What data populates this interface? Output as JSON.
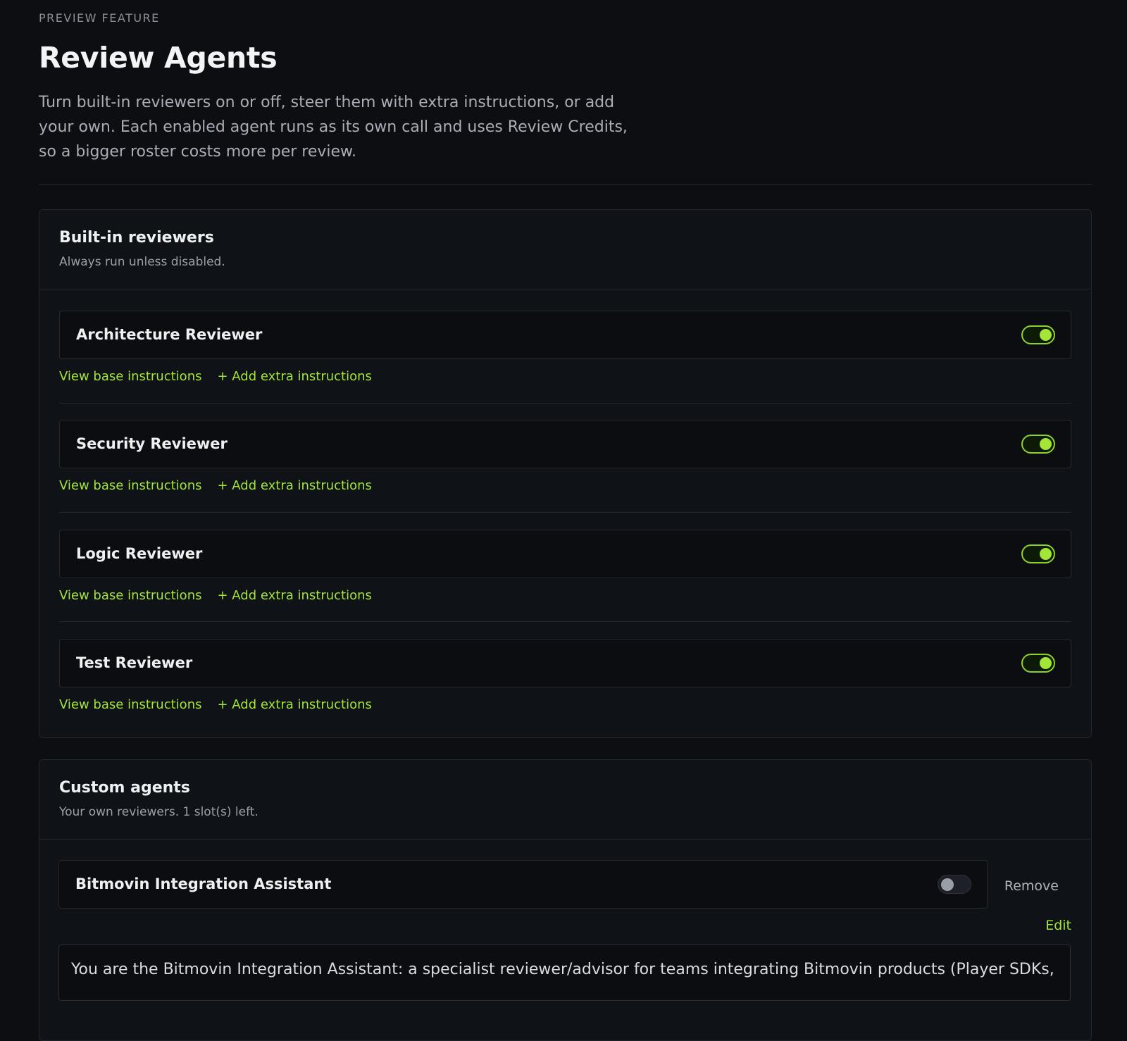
{
  "header": {
    "eyebrow": "PREVIEW FEATURE",
    "title": "Review Agents",
    "intro": "Turn built-in reviewers on or off, steer them with extra instructions, or add your own. Each enabled agent runs as its own call and uses Review Credits, so a bigger roster costs more per review."
  },
  "builtin": {
    "title": "Built-in reviewers",
    "subtitle": "Always run unless disabled.",
    "view_label": "View base instructions",
    "add_label": "+ Add extra instructions",
    "reviewers": [
      {
        "name": "Architecture Reviewer",
        "enabled": true
      },
      {
        "name": "Security Reviewer",
        "enabled": true
      },
      {
        "name": "Logic Reviewer",
        "enabled": true
      },
      {
        "name": "Test Reviewer",
        "enabled": true
      }
    ]
  },
  "custom": {
    "title": "Custom agents",
    "subtitle": "Your own reviewers. 1 slot(s) left.",
    "agent": {
      "name": "Bitmovin Integration Assistant",
      "enabled": false,
      "remove_label": "Remove",
      "edit_label": "Edit",
      "prompt": "You are the Bitmovin Integration Assistant: a specialist reviewer/advisor for teams integrating Bitmovin products (Player SDKs,"
    }
  },
  "colors": {
    "accent": "#a3e635",
    "background": "#0c0e12",
    "card": "#0f1217"
  }
}
